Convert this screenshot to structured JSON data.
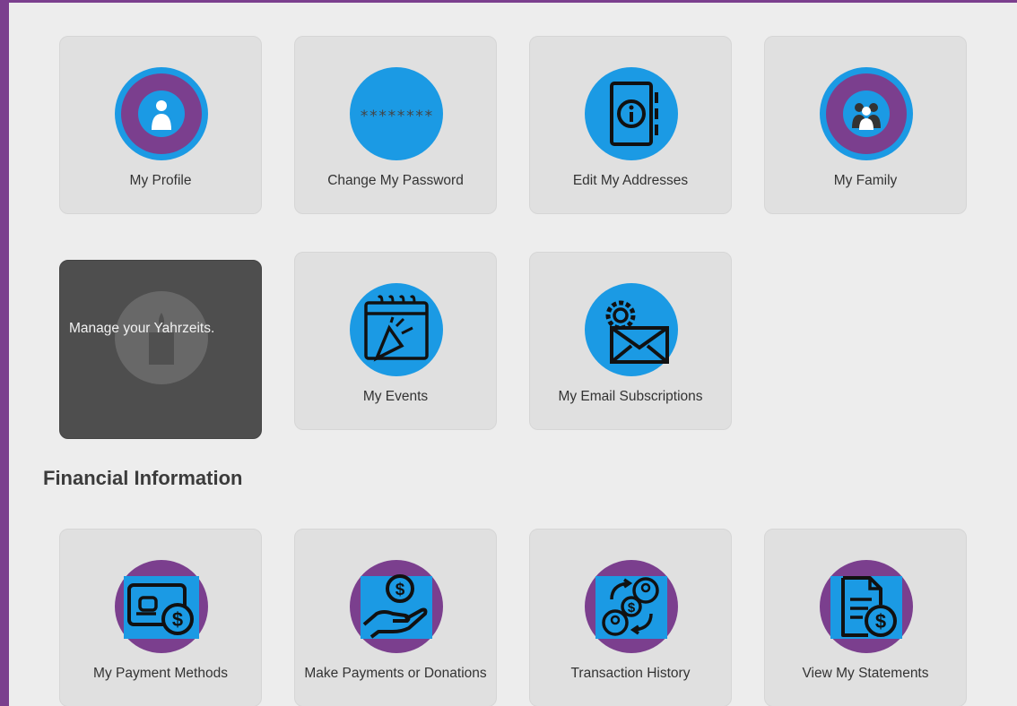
{
  "colors": {
    "accent_blue": "#1b9ae4",
    "accent_purple": "#7b3f8e",
    "card_bg": "#e0e0e0",
    "dark_card_bg": "#4e4e4e"
  },
  "account_cards": [
    {
      "label": "My Profile",
      "icon": "user-icon"
    },
    {
      "label": "Change My Password",
      "icon": "password-icon",
      "icon_text": "********"
    },
    {
      "label": "Edit My Addresses",
      "icon": "address-book-icon"
    },
    {
      "label": "My Family",
      "icon": "family-icon"
    },
    {
      "label": "",
      "icon": "candle-icon",
      "overlay_text": "Manage your Yahrzeits."
    },
    {
      "label": "My Events",
      "icon": "calendar-party-icon"
    },
    {
      "label": "My Email Subscriptions",
      "icon": "email-gear-icon"
    }
  ],
  "financial": {
    "title": "Financial Information",
    "cards": [
      {
        "label": "My Payment Methods",
        "icon": "wallet-dollar-icon"
      },
      {
        "label": "Make Payments or Donations",
        "icon": "hand-dollar-icon"
      },
      {
        "label": "Transaction History",
        "icon": "transaction-exchange-icon"
      },
      {
        "label": "View My Statements",
        "icon": "statement-dollar-icon"
      }
    ]
  }
}
